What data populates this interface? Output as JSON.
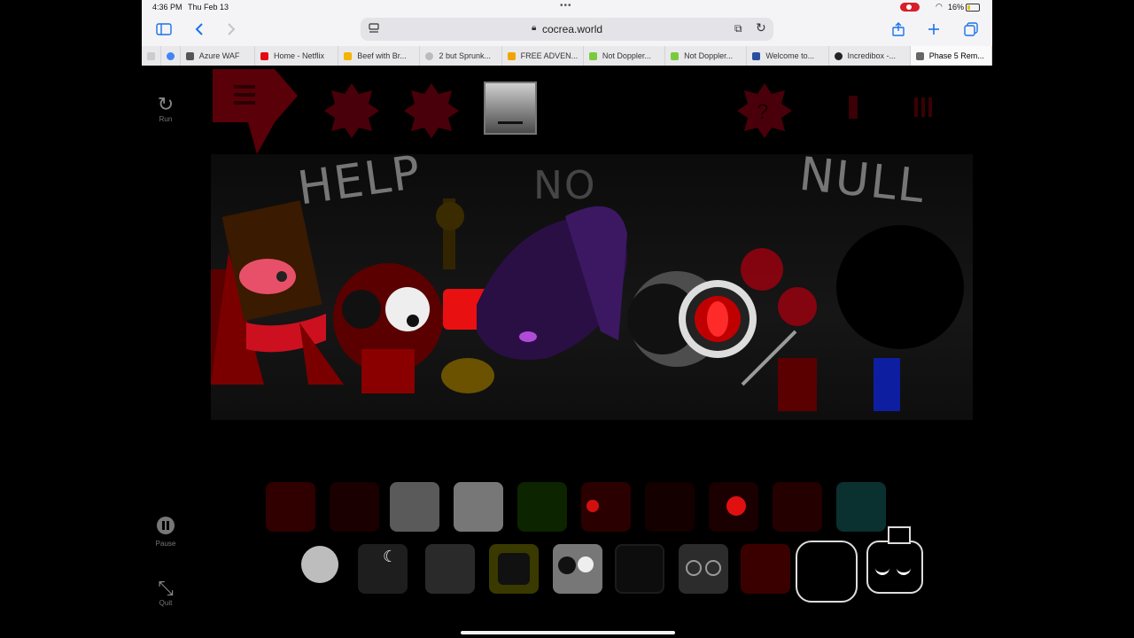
{
  "status_bar": {
    "time": "4:36 PM",
    "date": "Thu Feb 13",
    "battery": "16%"
  },
  "browser": {
    "url": "cocrea.world",
    "tabs": [
      {
        "label": "",
        "color": "#cccccc"
      },
      {
        "label": "",
        "color": "#4285f4"
      },
      {
        "label": "Azure WAF",
        "color": "#555555"
      },
      {
        "label": "Home - Netflix",
        "color": "#e50914"
      },
      {
        "label": "Beef with Br...",
        "color": "#f4b400"
      },
      {
        "label": "2 but Sprunk...",
        "color": "#bbbbbb"
      },
      {
        "label": "FREE ADVEN...",
        "color": "#f0a500"
      },
      {
        "label": "Not Doppler...",
        "color": "#7acb3c"
      },
      {
        "label": "Not Doppler...",
        "color": "#7acb3c"
      },
      {
        "label": "Welcome to...",
        "color": "#2b4fa0"
      },
      {
        "label": "Incredibox -...",
        "color": "#222222"
      },
      {
        "label": "Phase 5 Rem...",
        "color": "#666666"
      }
    ],
    "active_tab_index": 11
  },
  "game": {
    "controls": {
      "run": "Run",
      "pause": "Pause",
      "quit": "Quit"
    },
    "wall_texts": [
      "HELP",
      "NO",
      "NULL"
    ],
    "accent_red": "#b3001b",
    "accent_purple": "#4b1a7a"
  }
}
